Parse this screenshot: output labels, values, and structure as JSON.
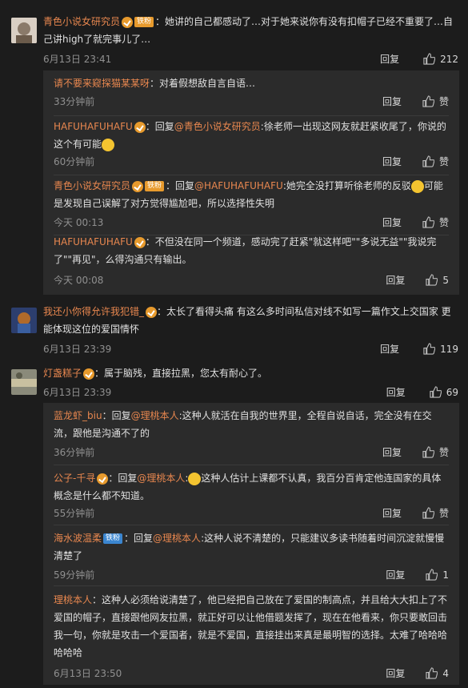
{
  "comments": [
    {
      "user": "青色小说女研究员",
      "badge": "铁粉",
      "text": "：她讲的自己都感动了…对于她来说你有没有扣帽子已经不重要了…自己讲high了就完事儿了…",
      "time": "6月13日 23:41",
      "reply": "回复",
      "likes": "212",
      "replies": [
        {
          "user": "请不要来窥探猫某某呀",
          "text": "：对着假想敌自言自语…",
          "time": "33分钟前",
          "reply": "回复",
          "likes": "赞"
        },
        {
          "user": "HAFUHAFUHAFU",
          "prefix": "：回复",
          "mention": "@青色小说女研究员",
          "text": ":徐老师一出现这网友就赶紧收尾了，你说的这个有可能",
          "time": "60分钟前",
          "reply": "回复",
          "likes": "赞"
        },
        {
          "user": "青色小说女研究员",
          "badge": "铁粉",
          "prefix": "：回复",
          "mention": "@HAFUHAFUHAFU",
          "text": ":她完全没打算听徐老师的反驳",
          "text2": "可能是发现自己误解了对方觉得尴尬吧，所以选择性失明",
          "time": "今天 00:13",
          "reply": "回复",
          "likes": "赞"
        },
        {
          "user": "HAFUHAFUHAFU",
          "text": "：不但没在同一个频道，感动完了赶紧\"就这样吧\"\"多说无益\"\"我说完了\"\"再见\"，么得沟通只有输出。",
          "time": "今天 00:08",
          "reply": "回复",
          "likes": "5"
        }
      ]
    },
    {
      "user": "我还小你得允许我犯错_",
      "text": "：太长了看得头痛 有这么多时间私信对线不如写一篇作文上交国家 更能体现这位的爱国情怀",
      "time": "6月13日 23:39",
      "reply": "回复",
      "likes": "119"
    },
    {
      "user": "灯盏糕子",
      "text": "：属于脑残，直接拉黑，您太有耐心了。",
      "time": "6月13日 23:39",
      "reply": "回复",
      "likes": "69",
      "replies": [
        {
          "user": "蓝龙虾_biu",
          "prefix": "：回复",
          "mention": "@理桃本人",
          "text": ":这种人就活在自我的世界里，全程自说自话，完全没有在交流，跟他是沟通不了的",
          "time": "36分钟前",
          "reply": "回复",
          "likes": "赞"
        },
        {
          "user": "公子-千寻",
          "prefix": "：回复",
          "mention": "@理桃本人",
          "text": ":",
          "text2": "这种人估计上课都不认真，我百分百肯定他连国家的具体概念是什么都不知道。",
          "time": "55分钟前",
          "reply": "回复",
          "likes": "赞"
        },
        {
          "user": "海水波温柔",
          "badge": "铁粉",
          "prefix": "：回复",
          "mention": "@理桃本人",
          "text": ":这种人说不清楚的，只能建议多读书随着时间沉淀就慢慢清楚了",
          "time": "59分钟前",
          "reply": "回复",
          "likes": "1"
        },
        {
          "user": "理桃本人",
          "text": "：这种人必须给说清楚了，他已经把自己放在了爱国的制高点，并且给大大扣上了不爱国的帽子，直接跟他网友拉黑，就正好可以让他借题发挥了，现在在他看来，你只要敢回击我一句，你就是攻击一个爱国者，就是不爱国，直接挂出来真是最明智的选择。太难了哈哈哈哈哈哈",
          "time": "6月13日 23:50",
          "reply": "回复",
          "likes": "4"
        }
      ]
    }
  ]
}
